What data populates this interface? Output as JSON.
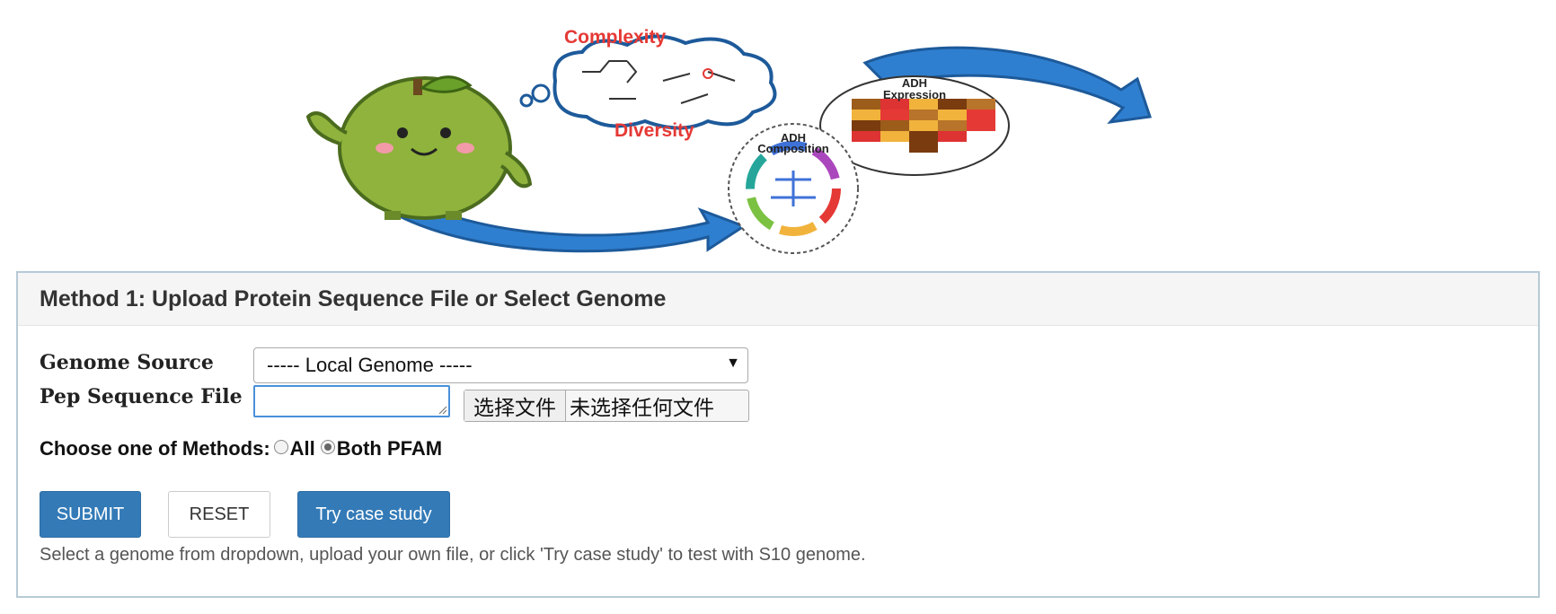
{
  "banner": {
    "complexity_label": "Complexity",
    "diversity_label": "Diversity",
    "adh_expression_label_1": "ADH",
    "adh_expression_label_2": "Expression",
    "adh_composition_label_1": "ADH",
    "adh_composition_label_2": "Composition"
  },
  "panel": {
    "title": "Method 1: Upload Protein Sequence File or Select Genome"
  },
  "form": {
    "genome_source_label": "Genome Source",
    "genome_source_selected": "----- Local Genome -----",
    "pep_file_label": "Pep Sequence File",
    "pep_textarea_value": "",
    "file_button_label": "选择文件",
    "file_status": "未选择任何文件",
    "methods_label": "Choose one of Methods:",
    "method_options": [
      {
        "label": "All",
        "checked": false
      },
      {
        "label": "Both PFAM",
        "checked": true
      }
    ]
  },
  "buttons": {
    "submit": "SUBMIT",
    "reset": "RESET",
    "case_study": "Try case study"
  },
  "hint": "Select a genome from dropdown, upload your own file, or click 'Try case study' to test with S10 genome.",
  "colors": {
    "primary": "#337ab7",
    "panel_border": "#b7cad6",
    "heading_red": "#e53935",
    "arrow_blue": "#2f7fd0"
  }
}
